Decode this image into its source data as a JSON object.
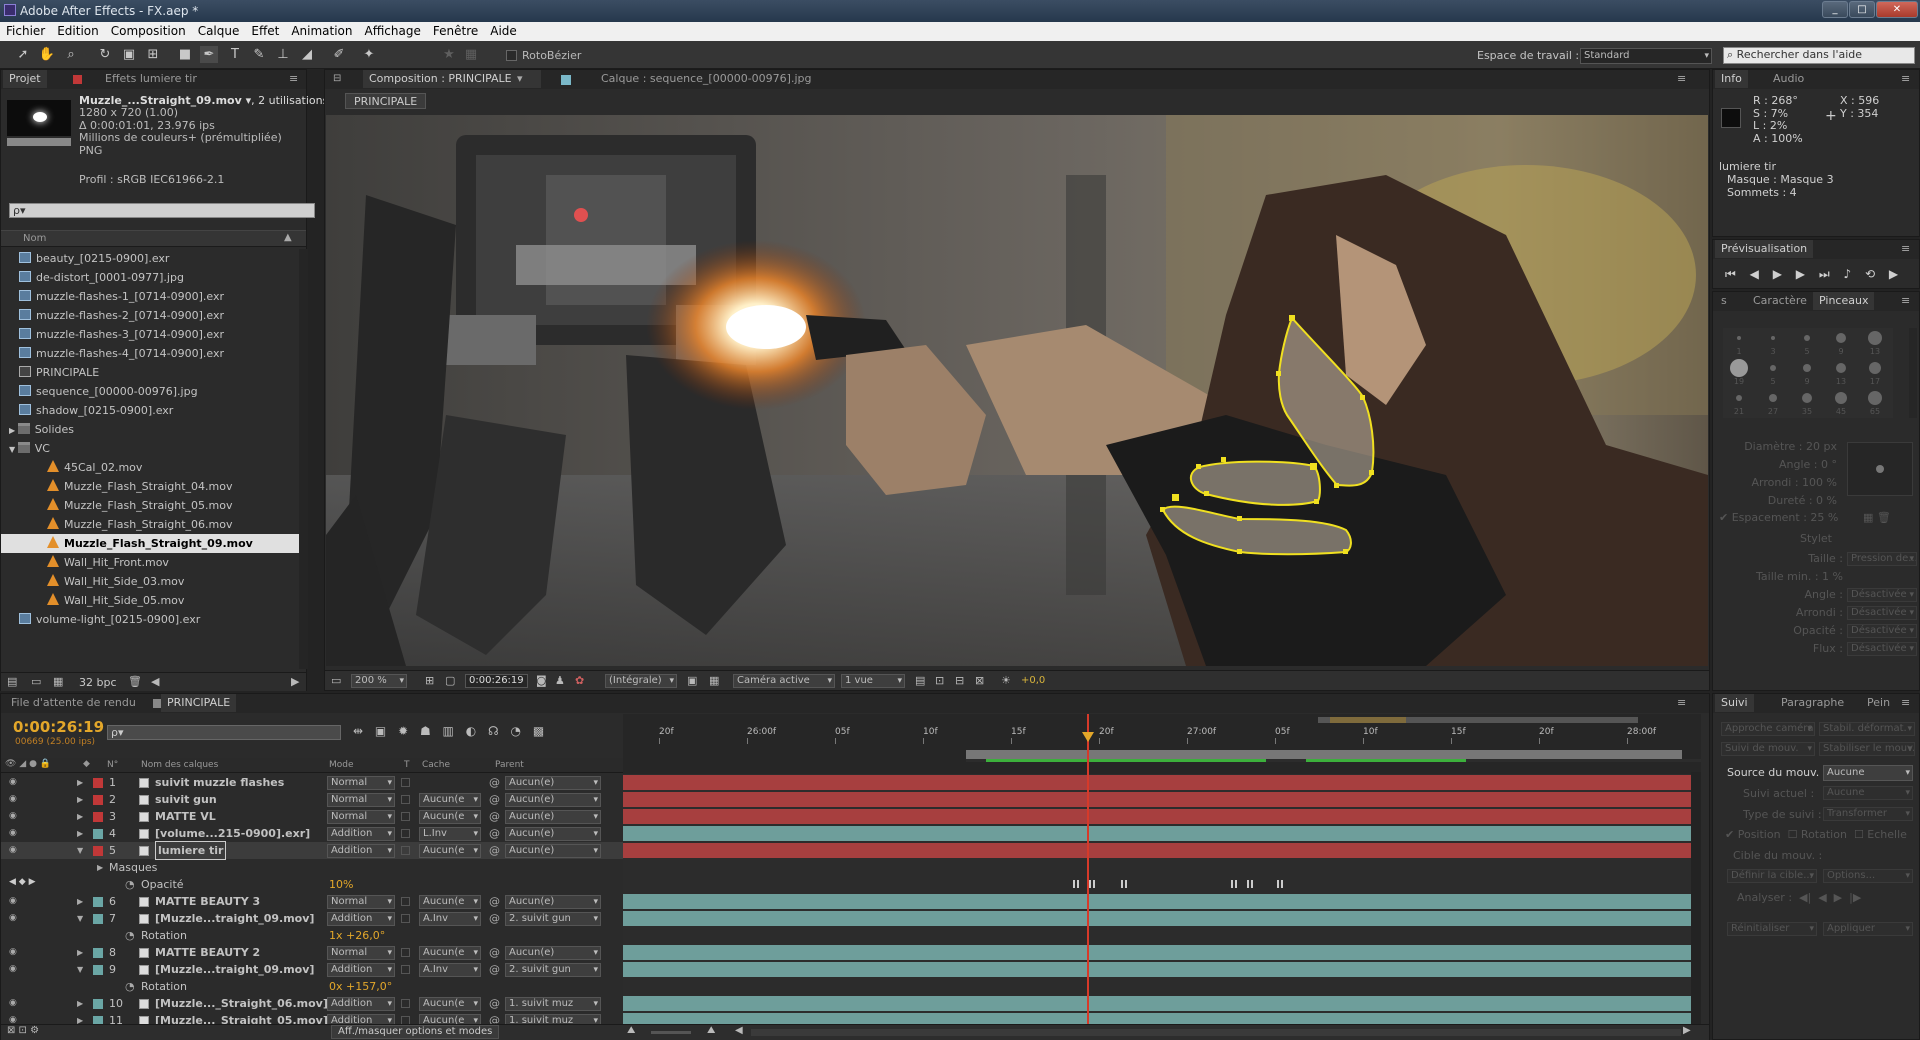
{
  "window": {
    "title": "Adobe After Effects - FX.aep *",
    "controls": [
      "_",
      "□",
      "✕"
    ]
  },
  "menu": [
    "Fichier",
    "Edition",
    "Composition",
    "Calque",
    "Effet",
    "Animation",
    "Affichage",
    "Fenêtre",
    "Aide"
  ],
  "toolbar": {
    "rotobezier": "RotoBézier",
    "workspace_label": "Espace de travail :",
    "workspace": "Standard",
    "help_search": "Rechercher dans l'aide"
  },
  "project": {
    "tabs": [
      "Projet",
      "Effets lumiere tir"
    ],
    "selected_name": "Muzzle_...Straight_09.mov ▾",
    "selected_uses": ", 2 utilisations",
    "info": [
      "1280 x 720 (1.00)",
      "Δ 0:00:01:01, 23.976 ips",
      "Millions de couleurs+ (prémultipliée)",
      "PNG"
    ],
    "profile": "Profil : sRGB IEC61966-2.1",
    "search_placeholder": "ρ▾",
    "col_name": "Nom",
    "files": [
      {
        "name": "beauty_[0215-0900].exr",
        "icon": "img"
      },
      {
        "name": "de-distort_[0001-0977].jpg",
        "icon": "img"
      },
      {
        "name": "muzzle-flashes-1_[0714-0900].exr",
        "icon": "img"
      },
      {
        "name": "muzzle-flashes-2_[0714-0900].exr",
        "icon": "img"
      },
      {
        "name": "muzzle-flashes-3_[0714-0900].exr",
        "icon": "img"
      },
      {
        "name": "muzzle-flashes-4_[0714-0900].exr",
        "icon": "img"
      },
      {
        "name": "PRINCIPALE",
        "icon": "comp"
      },
      {
        "name": "sequence_[00000-00976].jpg",
        "icon": "img"
      },
      {
        "name": "shadow_[0215-0900].exr",
        "icon": "img"
      },
      {
        "name": "Solides",
        "icon": "fold"
      },
      {
        "name": "VC",
        "icon": "fold"
      },
      {
        "name": "45Cal_02.mov",
        "icon": "cone"
      },
      {
        "name": "Muzzle_Flash_Straight_04.mov",
        "icon": "cone"
      },
      {
        "name": "Muzzle_Flash_Straight_05.mov",
        "icon": "cone"
      },
      {
        "name": "Muzzle_Flash_Straight_06.mov",
        "icon": "cone"
      },
      {
        "name": "Muzzle_Flash_Straight_09.mov",
        "icon": "cone"
      },
      {
        "name": "Wall_Hit_Front.mov",
        "icon": "cone"
      },
      {
        "name": "Wall_Hit_Side_03.mov",
        "icon": "cone"
      },
      {
        "name": "Wall_Hit_Side_05.mov",
        "icon": "cone"
      },
      {
        "name": "volume-light_[0215-0900].exr",
        "icon": "img"
      }
    ],
    "bpc": "32 bpc"
  },
  "viewer": {
    "tab_comp": "Composition : PRINCIPALE",
    "tab_layer": "Calque : sequence_[00000-00976].jpg",
    "crumb": "PRINCIPALE",
    "zoom": "200 %",
    "time": "0:00:26:19",
    "resolution": "(Intégrale)",
    "camera": "Caméra active",
    "views": "1 vue",
    "exposure": "+0,0"
  },
  "info_panel": {
    "tabs": [
      "Info",
      "Audio"
    ],
    "r": "R : 268°",
    "g": "S : 7%",
    "b": "L : 2%",
    "a": "A : 100%",
    "x": "X : 596",
    "y": "Y : 354",
    "layer": "lumiere tir",
    "mask": "Masque : Masque 3",
    "verts": "Sommets : 4"
  },
  "preview": {
    "title": "Prévisualisation"
  },
  "brushes": {
    "tabs": [
      "Caractère",
      "Pinceaux"
    ],
    "sizes": [
      "1",
      "3",
      "5",
      "9",
      "13",
      "19",
      "5",
      "9",
      "13",
      "17",
      "21",
      "27",
      "35",
      "45",
      "65"
    ],
    "diam": "Diamètre : 20 px",
    "angle": "Angle : 0 °",
    "round": "Arrondi : 100 %",
    "hard": "Dureté : 0 %",
    "spacing": "Espacement : 25 %",
    "stylus": "Stylet",
    "taille": "Taille :",
    "taille_v": "Pression de...",
    "tmin": "Taille min. : 1 %",
    "angle2": "Angle :",
    "round2": "Arrondi :",
    "opac": "Opacité :",
    "flux": "Flux :",
    "off": "Désactivée"
  },
  "tracker": {
    "tabs": [
      "Suivi",
      "Paragraphe",
      "Pein"
    ],
    "b1": "Approche caméra",
    "b2": "Stabil. déformat.",
    "b3": "Suivi de mouv.",
    "b4": "Stabiliser le mouv.",
    "source_label": "Source du mouv. :",
    "source": "Aucune",
    "current_label": "Suivi actuel :",
    "current": "Aucune",
    "type_label": "Type de suivi :",
    "type": "Transformer",
    "pos": "Position",
    "rot": "Rotation",
    "scale": "Echelle",
    "target": "Cible du mouv. :",
    "define": "Définir la cible...",
    "options": "Options...",
    "analyze": "Analyser :",
    "reset": "Réinitialiser",
    "apply": "Appliquer"
  },
  "timeline": {
    "tabs": [
      "File d'attente de rendu",
      "PRINCIPALE"
    ],
    "time": "0:00:26:19",
    "frames": "00669 (25.00 ips)",
    "cols": {
      "num": "N°",
      "name": "Nom des calques",
      "mode": "Mode",
      "t": "T",
      "cache": "Cache",
      "parent": "Parent"
    },
    "ruler": [
      "20f",
      "26:00f",
      "05f",
      "10f",
      "15f",
      "20f",
      "27:00f",
      "05f",
      "10f",
      "15f",
      "20f",
      "28:00f"
    ],
    "toggle": "Aff./masquer options et modes",
    "layers": [
      {
        "n": "1",
        "name": "suivit muzzle flashes",
        "mode": "Normal",
        "cache": "",
        "parent": "Aucun(e)",
        "label": "#c13838",
        "bar": "red"
      },
      {
        "n": "2",
        "name": "suivit gun",
        "mode": "Normal",
        "cache": "Aucun(e",
        "parent": "Aucun(e)",
        "label": "#c13838",
        "bar": "red"
      },
      {
        "n": "3",
        "name": "MATTE VL",
        "mode": "Normal",
        "cache": "Aucun(e",
        "parent": "Aucun(e)",
        "label": "#c13838",
        "bar": "red"
      },
      {
        "n": "4",
        "name": "[volume...215-0900].exr]",
        "mode": "Addition",
        "cache": "L.Inv",
        "parent": "Aucun(e)",
        "label": "#6aa6a5",
        "bar": "teal"
      },
      {
        "n": "5",
        "name": "lumiere tir",
        "mode": "Addition",
        "cache": "Aucun(e",
        "parent": "Aucun(e)",
        "label": "#c13838",
        "bar": "red"
      }
    ],
    "masks_label": "Masques",
    "opacity_label": "Opacité",
    "opacity_value": "10%",
    "layers2": [
      {
        "n": "6",
        "name": "MATTE BEAUTY 3",
        "mode": "Normal",
        "cache": "Aucun(e",
        "parent": "Aucun(e)",
        "label": "#6aa6a5"
      },
      {
        "n": "7",
        "name": "[Muzzle...traight_09.mov]",
        "mode": "Addition",
        "cache": "A.Inv",
        "parent": "2. suivit gun",
        "label": "#6aa6a5"
      }
    ],
    "rot1_label": "Rotation",
    "rot1_value": "1x +26,0°",
    "layers3": [
      {
        "n": "8",
        "name": "MATTE BEAUTY 2",
        "mode": "Normal",
        "cache": "Aucun(e",
        "parent": "Aucun(e)",
        "label": "#6aa6a5"
      },
      {
        "n": "9",
        "name": "[Muzzle...traight_09.mov]",
        "mode": "Addition",
        "cache": "A.Inv",
        "parent": "2. suivit gun",
        "label": "#6aa6a5"
      }
    ],
    "rot2_label": "Rotation",
    "rot2_value": "0x +157,0°",
    "layers4": [
      {
        "n": "10",
        "name": "[Muzzle..._Straight_06.mov]",
        "mode": "Addition",
        "cache": "Aucun(e",
        "parent": "1. suivit muz",
        "label": "#6aa6a5"
      },
      {
        "n": "11",
        "name": "[Muzzle..._Straight_05.mov]",
        "mode": "Addition",
        "cache": "Aucun(e",
        "parent": "1. suivit muz",
        "label": "#6aa6a5"
      }
    ]
  }
}
